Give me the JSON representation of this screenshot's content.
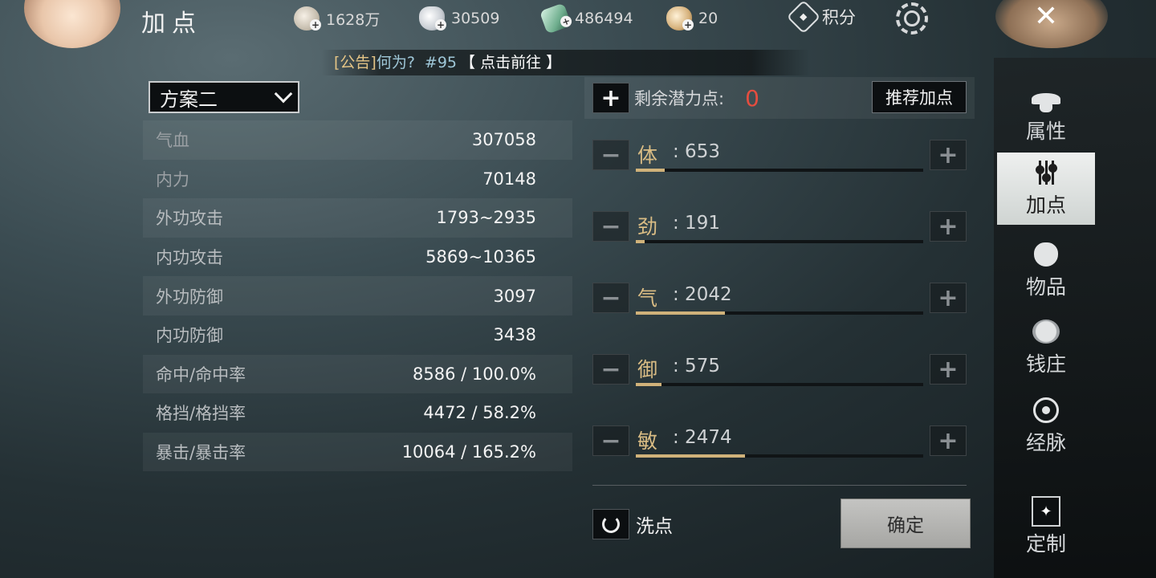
{
  "header": {
    "title": "加点",
    "currencies": [
      {
        "icon": "gold-coin-icon",
        "value": "1628万"
      },
      {
        "icon": "silver-ingot-icon",
        "value": "30509"
      },
      {
        "icon": "jade-icon",
        "value": "486494"
      },
      {
        "icon": "gold-ingot-icon",
        "value": "20"
      }
    ],
    "score_label": "积分",
    "close_symbol": "✕"
  },
  "announcement": {
    "tag": "[公告]",
    "question": "何为?",
    "number": "#95",
    "link": "【 点击前往 】"
  },
  "left": {
    "scheme": "方案二",
    "stats": [
      {
        "label": "气血",
        "value": "307058"
      },
      {
        "label": "内力",
        "value": "70148"
      },
      {
        "label": "外功攻击",
        "value": "1793~2935"
      },
      {
        "label": "内功攻击",
        "value": "5869~10365"
      },
      {
        "label": "外功防御",
        "value": "3097"
      },
      {
        "label": "内功防御",
        "value": "3438"
      },
      {
        "label": "命中/命中率",
        "value": "8586 / 100.0%"
      },
      {
        "label": "格挡/格挡率",
        "value": "4472 / 58.2%"
      },
      {
        "label": "暴击/暴击率",
        "value": "10064 / 165.2%"
      }
    ]
  },
  "right": {
    "remaining_label": "剩余潜力点:",
    "remaining_value": "0",
    "recommend_label": "推荐加点",
    "attributes": [
      {
        "name": "体",
        "value": ": 653",
        "fill": 0.1
      },
      {
        "name": "劲",
        "value": ": 191",
        "fill": 0.03
      },
      {
        "name": "气",
        "value": ": 2042",
        "fill": 0.31
      },
      {
        "name": "御",
        "value": ": 575",
        "fill": 0.09
      },
      {
        "name": "敏",
        "value": ": 2474",
        "fill": 0.38
      }
    ],
    "reset_label": "洗点",
    "confirm_label": "确定"
  },
  "sidebar": {
    "items": [
      {
        "label": "属性"
      },
      {
        "label": "加点"
      },
      {
        "label": "物品"
      },
      {
        "label": "钱庄"
      },
      {
        "label": "经脉"
      },
      {
        "label": "定制"
      }
    ]
  },
  "colors": {
    "accent_gold": "#d9bc84",
    "points_red": "#e54d3f",
    "announce_tag": "#e4c486",
    "announce_link": "#9fc7d8"
  }
}
